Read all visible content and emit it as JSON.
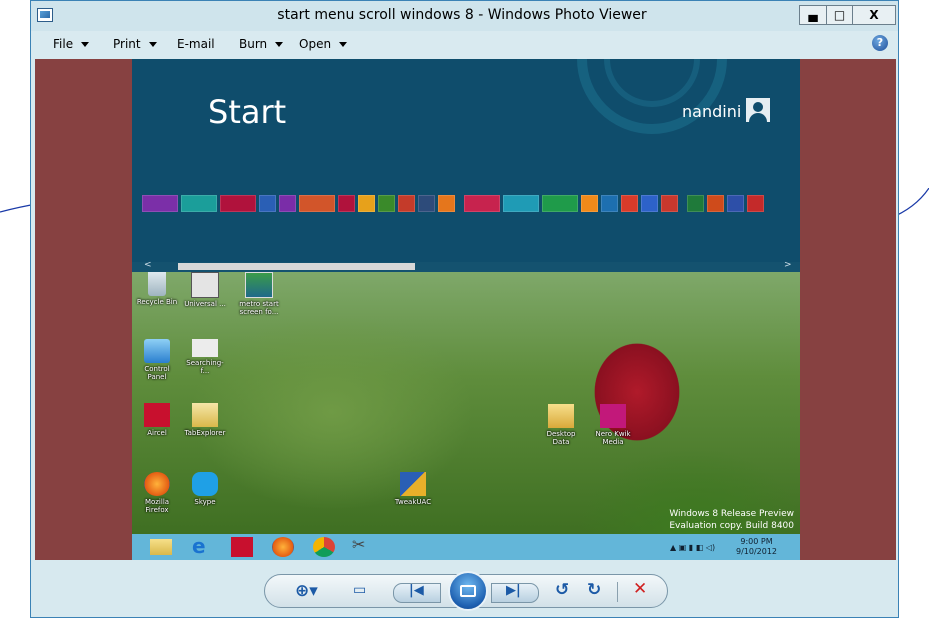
{
  "window": {
    "title": "start menu scroll windows 8 - Windows Photo Viewer",
    "controls": {
      "minimize": "▄",
      "maximize": "□",
      "close": "X"
    }
  },
  "menu": {
    "file": "File",
    "print": "Print",
    "email": "E-mail",
    "burn": "Burn",
    "open": "Open",
    "help": "?"
  },
  "start": {
    "title": "Start",
    "username": "nandini",
    "scroll_left": "<",
    "scroll_right": ">",
    "tiles": [
      {
        "color": "#7b2fa8",
        "icon": "mail-icon"
      },
      {
        "color": "#1b9e9a",
        "icon": "people-icon"
      },
      {
        "color": "#b0123c",
        "icon": "video-icon"
      },
      {
        "color": "#2a5fb5",
        "icon": "ie-icon"
      },
      {
        "color": "#7a2da8",
        "icon": "store-icon"
      },
      {
        "color": "#d2552a",
        "icon": "music-icon"
      },
      {
        "color": "#b0123c",
        "icon": "camera-icon"
      },
      {
        "color": "#e7a11b",
        "icon": "chrome-icon"
      },
      {
        "color": "#3a8a2a",
        "icon": "app-icon"
      },
      {
        "color": "#c43b2a",
        "icon": "aircel-icon"
      },
      {
        "color": "#2d4b7a",
        "icon": "app-icon"
      },
      {
        "color": "#e5761c",
        "icon": "firefox-icon"
      },
      {
        "color": "#c7234e",
        "icon": "calendar-icon"
      },
      {
        "color": "#1f9bb5",
        "icon": "finance-icon"
      },
      {
        "color": "#1f9b4a",
        "icon": "chart-icon"
      },
      {
        "color": "#f08a1a",
        "icon": "onenote-icon"
      },
      {
        "color": "#1d6fb0",
        "icon": "app-icon"
      },
      {
        "color": "#d83b2a",
        "icon": "app-icon"
      },
      {
        "color": "#2d62c9",
        "icon": "outlook-icon"
      },
      {
        "color": "#c8382d",
        "icon": "powerpoint-icon"
      },
      {
        "color": "#1f7a3a",
        "icon": "excel-icon"
      },
      {
        "color": "#cf4b1b",
        "icon": "office-icon"
      },
      {
        "color": "#2d4fa8",
        "icon": "word-icon"
      },
      {
        "color": "#c42a2a",
        "icon": "app-icon"
      }
    ]
  },
  "desktop": {
    "icons": [
      {
        "label": "Recycle Bin",
        "icon": "recycle-bin-icon"
      },
      {
        "label": "Universal ...",
        "icon": "universal-icon"
      },
      {
        "label": "metro start screen fo...",
        "icon": "image-file-icon"
      },
      {
        "label": "Control Panel",
        "icon": "control-panel-icon"
      },
      {
        "label": "Searching-f...",
        "icon": "file-icon"
      },
      {
        "label": "Aircel",
        "icon": "aircel-icon"
      },
      {
        "label": "TabExplorer",
        "icon": "tabexplorer-icon"
      },
      {
        "label": "Mozilla Firefox",
        "icon": "firefox-icon"
      },
      {
        "label": "Skype",
        "icon": "skype-icon"
      },
      {
        "label": "TweakUAC",
        "icon": "tweakuac-icon"
      },
      {
        "label": "Desktop Data",
        "icon": "folder-icon"
      },
      {
        "label": "Nero Kwik Media",
        "icon": "nero-icon"
      }
    ],
    "watermark": [
      "Windows 8 Release Preview",
      "Evaluation copy. Build 8400"
    ]
  },
  "taskbar": {
    "icons": [
      "explorer-icon",
      "ie-icon",
      "aircel-icon",
      "firefox-icon",
      "chrome-icon",
      "snipping-icon"
    ],
    "time": "9:00 PM",
    "date": "9/10/2012"
  },
  "viewer_controls": [
    "zoom-icon",
    "fit-icon",
    "previous-icon",
    "slideshow-icon",
    "next-icon",
    "rotate-left-icon",
    "rotate-right-icon",
    "delete-icon"
  ],
  "colors": {
    "background_mat": "#874141",
    "start_bg": "#0f4d6c",
    "taskbar": "#63b6d9",
    "arrow": "#1a3aa8"
  }
}
